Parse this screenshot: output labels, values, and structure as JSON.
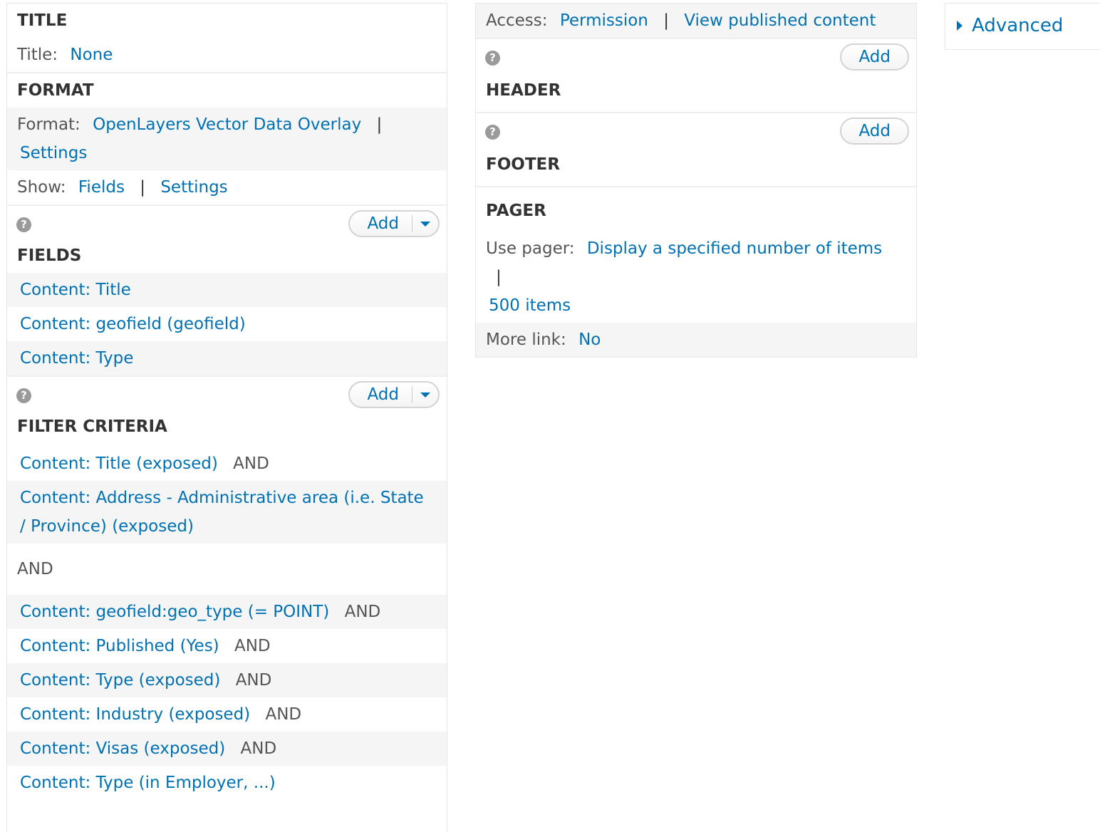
{
  "left": {
    "title_section": {
      "heading": "TITLE",
      "title_label": "Title:",
      "title_value": "None"
    },
    "format_section": {
      "heading": "FORMAT",
      "format_label": "Format:",
      "format_value": "OpenLayers Vector Data Overlay",
      "format_sep": "|",
      "format_settings": "Settings",
      "show_label": "Show:",
      "show_value": "Fields",
      "show_sep": "|",
      "show_settings": "Settings"
    },
    "fields_section": {
      "help": "?",
      "add_label": "Add",
      "heading": "FIELDS",
      "items": [
        "Content: Title",
        "Content: geofield (geofield)",
        "Content: Type"
      ]
    },
    "filter_section": {
      "help": "?",
      "add_label": "Add",
      "heading": "FILTER CRITERIA",
      "group1": [
        {
          "label": "Content: Title (exposed)",
          "op": "AND"
        },
        {
          "label": "Content: Address - Administrative area (i.e. State / Province) (exposed)",
          "op": ""
        }
      ],
      "between": "AND",
      "group2": [
        {
          "label": "Content: geofield:geo_type (= POINT)",
          "op": "AND"
        },
        {
          "label": "Content: Published (Yes)",
          "op": "AND"
        },
        {
          "label": "Content: Type (exposed)",
          "op": "AND"
        },
        {
          "label": "Content: Industry (exposed)",
          "op": "AND"
        },
        {
          "label": "Content: Visas (exposed)",
          "op": "AND"
        },
        {
          "label": "Content: Type (in Employer, ...)",
          "op": ""
        }
      ]
    }
  },
  "middle": {
    "access": {
      "label": "Access:",
      "value1": "Permission",
      "sep": "|",
      "value2": "View published content"
    },
    "header_section": {
      "help": "?",
      "add_label": "Add",
      "heading": "HEADER"
    },
    "footer_section": {
      "help": "?",
      "add_label": "Add",
      "heading": "FOOTER"
    },
    "pager_section": {
      "heading": "PAGER",
      "use_pager_label": "Use pager:",
      "use_pager_value": "Display a specified number of items",
      "sep": "|",
      "items_value": "500 items",
      "more_link_label": "More link:",
      "more_link_value": "No"
    }
  },
  "right": {
    "advanced_label": "Advanced"
  },
  "colors": {
    "link": "#0071b3",
    "text": "#333333",
    "alt_row": "#f5f5f5",
    "border": "#e6e6e6"
  }
}
